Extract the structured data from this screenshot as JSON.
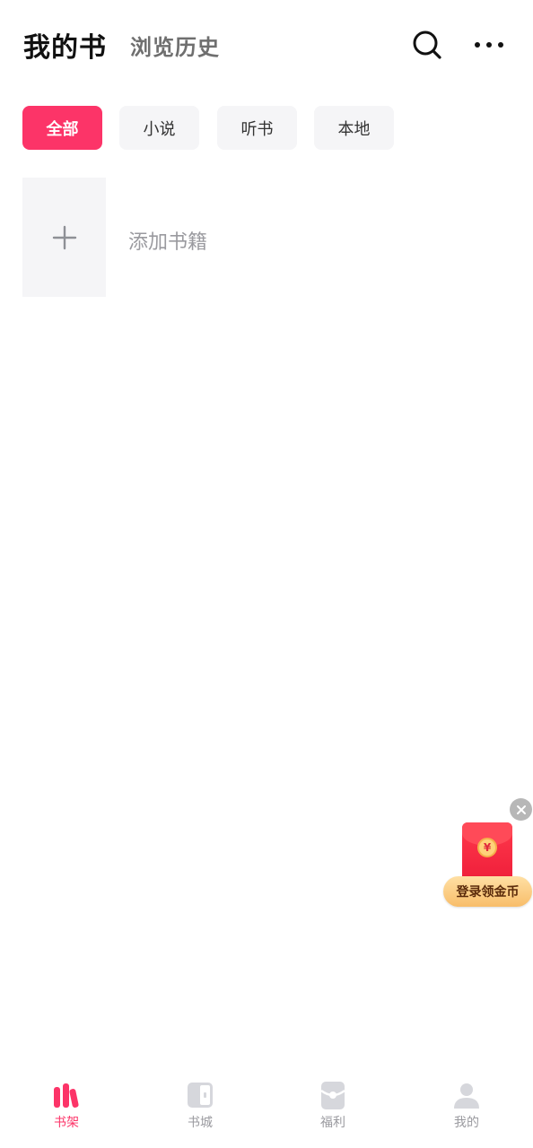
{
  "header": {
    "title": "我的书",
    "history_tab": "浏览历史",
    "icons": [
      "search-icon",
      "more-icon"
    ]
  },
  "filters": [
    {
      "label": "全部",
      "active": true
    },
    {
      "label": "小说",
      "active": false
    },
    {
      "label": "听书",
      "active": false
    },
    {
      "label": "本地",
      "active": false
    }
  ],
  "shelf": {
    "add_label": "添加书籍",
    "add_icon": "plus-icon"
  },
  "promo": {
    "button_label": "登录领金币",
    "coin_symbol": "¥",
    "icons": [
      "close-icon",
      "red-packet-icon"
    ]
  },
  "bottom_nav": [
    {
      "label": "书架",
      "icon": "bookshelf-icon",
      "active": true
    },
    {
      "label": "书城",
      "icon": "bookstore-icon",
      "active": false
    },
    {
      "label": "福利",
      "icon": "welfare-icon",
      "active": false
    },
    {
      "label": "我的",
      "icon": "profile-icon",
      "active": false
    }
  ],
  "colors": {
    "accent": "#fc3468",
    "chip_bg": "#f5f5f7",
    "muted_text": "#9a9a9f"
  }
}
